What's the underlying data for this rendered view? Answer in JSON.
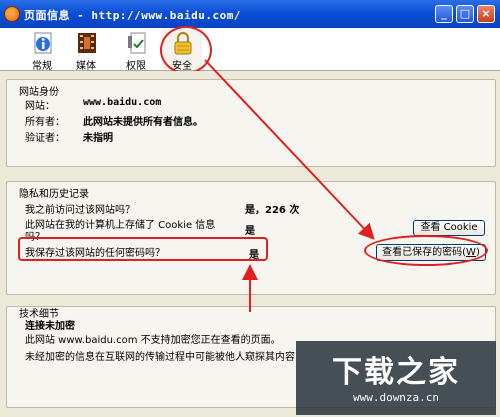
{
  "window": {
    "title": "页面信息 - http://www.baidu.com/"
  },
  "toolbar": {
    "tabs": [
      {
        "label": "常规",
        "icon": "info-icon"
      },
      {
        "label": "媒体",
        "icon": "media-icon"
      },
      {
        "label": "权限",
        "icon": "permissions-icon"
      },
      {
        "label": "安全",
        "icon": "padlock-icon",
        "selected": true
      }
    ]
  },
  "identity": {
    "heading": "网站身份",
    "website_label": "网站：",
    "website_value": "www.baidu.com",
    "owner_label": "所有者：",
    "owner_value": "此网站未提供所有者信息。",
    "verifier_label": "验证者：",
    "verifier_value": "未指明"
  },
  "privacy": {
    "heading": "隐私和历史记录",
    "q1": "我之前访问过该网站吗？",
    "a1": "是，226 次",
    "q2_line1": "此网站在我的计算机上存储了 Cookie 信息",
    "q2_line2": "吗？",
    "a2": "是",
    "q3": "我保存过该网站的任何密码吗？",
    "a3": "是",
    "view_cookies": "查看 Cookie",
    "view_passwords": "查看已保存的密码",
    "view_passwords_key": "W"
  },
  "technical": {
    "heading": "技术细节",
    "status": "连接未加密",
    "line1": "此网站 www.baidu.com 不支持加密您正在查看的页面。",
    "line2": "未经加密的信息在互联网的传输过程中可能被他人窥探其内容"
  },
  "watermark": {
    "title": "下载之家",
    "url": "www.downza.cn"
  },
  "colors": {
    "annotation_red": "#e02020",
    "titlebar_blue": "#0b4fd6"
  }
}
